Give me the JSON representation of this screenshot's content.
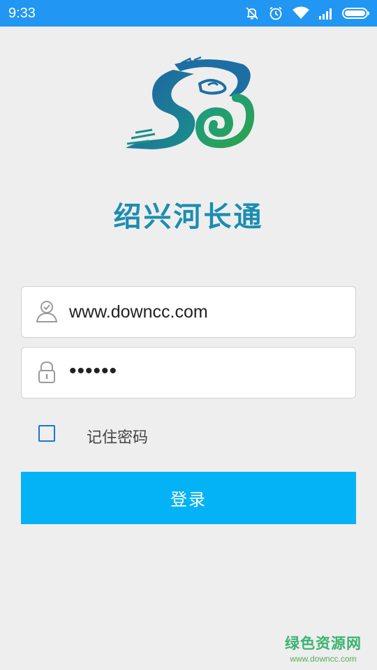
{
  "status_bar": {
    "time": "9:33",
    "icons": [
      "bell-off-icon",
      "alarm-icon",
      "wifi-icon",
      "signal-icon",
      "battery-icon"
    ]
  },
  "app": {
    "title": "绍兴河长通"
  },
  "login_form": {
    "username_value": "www.downcc.com",
    "password_value": "••••••",
    "remember_label": "记住密码",
    "remember_checked": false,
    "submit_label": "登录"
  },
  "watermark": {
    "title": "绿色资源网",
    "url": "www.downcc.com"
  },
  "colors": {
    "status_bar": "#2196f3",
    "title": "#1b8db0",
    "button": "#03b3f5",
    "checkbox": "#1976d2",
    "watermark": "#3cb371"
  }
}
